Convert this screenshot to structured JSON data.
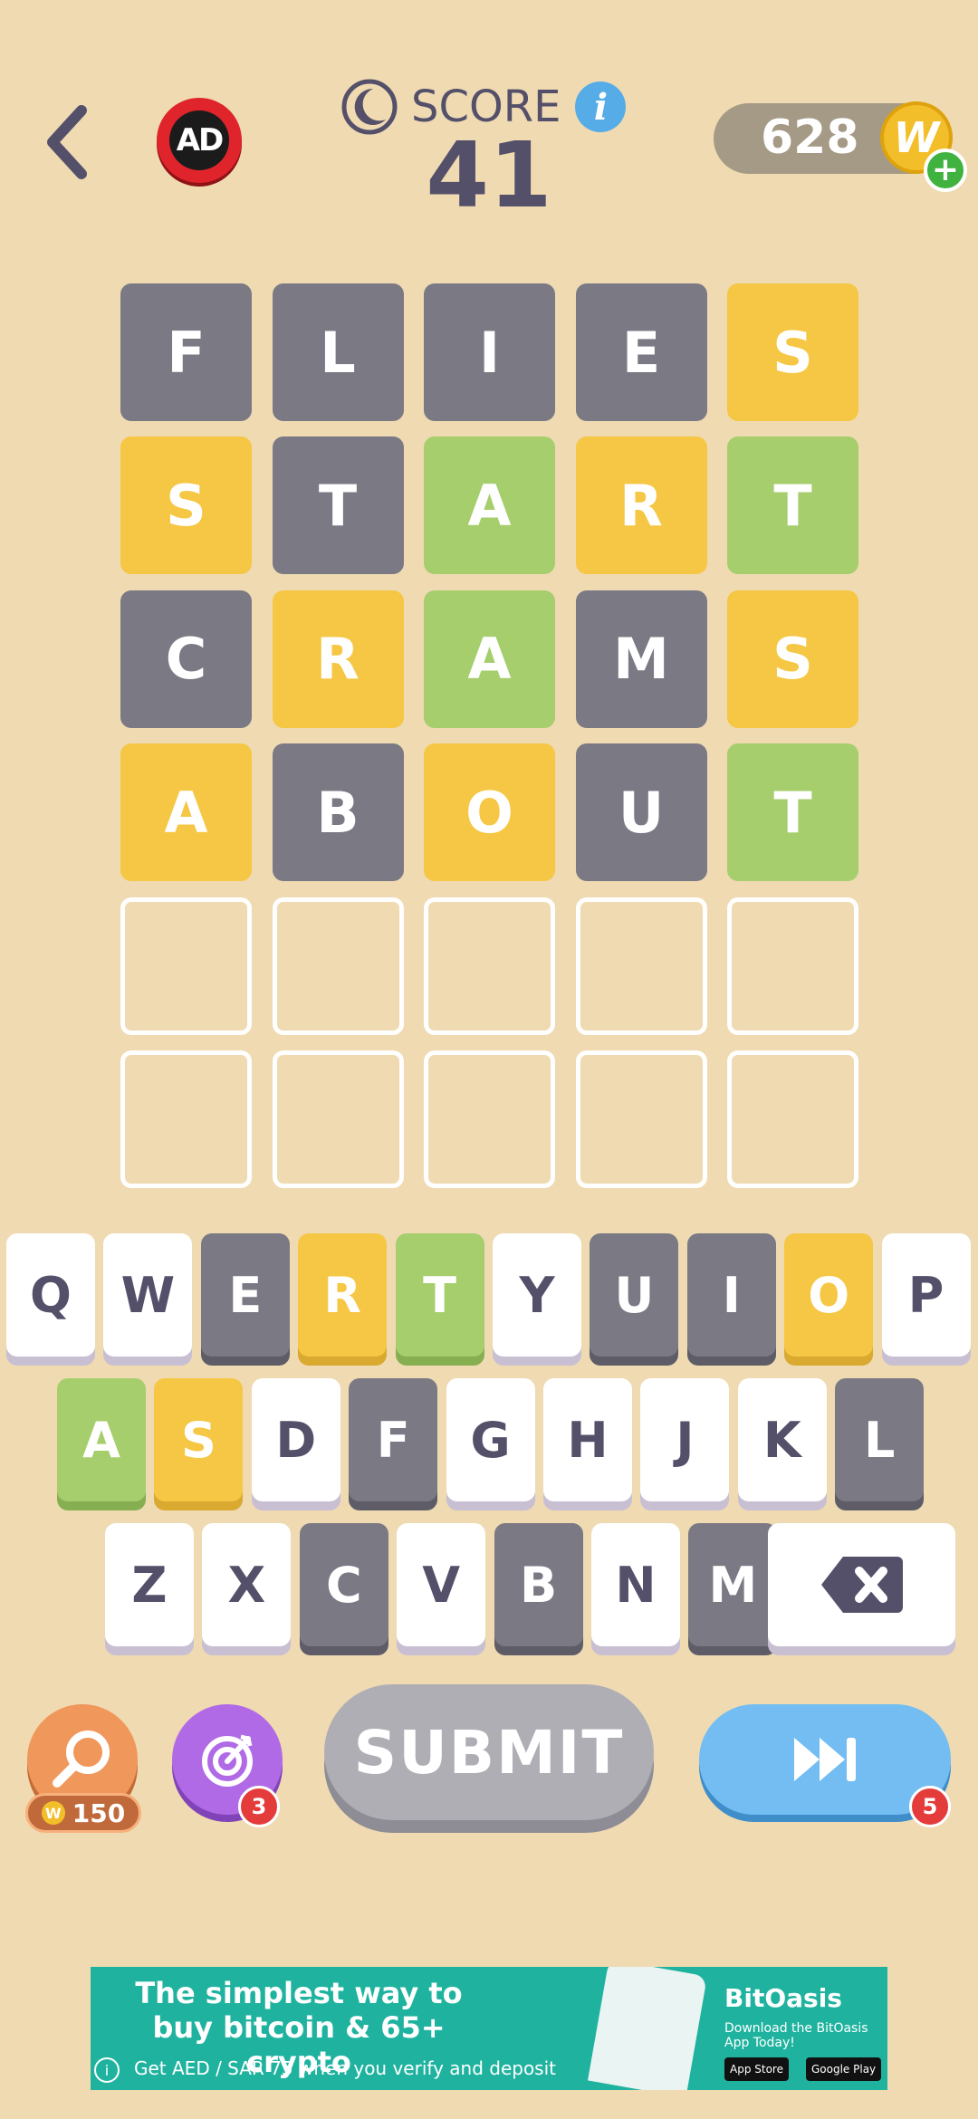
{
  "header": {
    "score_label": "SCORE",
    "score_value": "41",
    "info_glyph": "i",
    "coins": "628",
    "coin_glyph": "W",
    "plus_glyph": "+",
    "ad_label": "AD",
    "icons": [
      "back-chevron-icon",
      "ad-icon",
      "moon-icon",
      "info-icon",
      "coin-icon",
      "plus-icon"
    ]
  },
  "board": {
    "rows": [
      [
        {
          "l": "F",
          "s": "gray"
        },
        {
          "l": "L",
          "s": "gray"
        },
        {
          "l": "I",
          "s": "gray"
        },
        {
          "l": "E",
          "s": "gray"
        },
        {
          "l": "S",
          "s": "yellow"
        }
      ],
      [
        {
          "l": "S",
          "s": "yellow"
        },
        {
          "l": "T",
          "s": "gray"
        },
        {
          "l": "A",
          "s": "green"
        },
        {
          "l": "R",
          "s": "yellow"
        },
        {
          "l": "T",
          "s": "green"
        }
      ],
      [
        {
          "l": "C",
          "s": "gray"
        },
        {
          "l": "R",
          "s": "yellow"
        },
        {
          "l": "A",
          "s": "green"
        },
        {
          "l": "M",
          "s": "gray"
        },
        {
          "l": "S",
          "s": "yellow"
        }
      ],
      [
        {
          "l": "A",
          "s": "yellow"
        },
        {
          "l": "B",
          "s": "gray"
        },
        {
          "l": "O",
          "s": "yellow"
        },
        {
          "l": "U",
          "s": "gray"
        },
        {
          "l": "T",
          "s": "green"
        }
      ],
      [
        {
          "l": "",
          "s": "empty"
        },
        {
          "l": "",
          "s": "empty"
        },
        {
          "l": "",
          "s": "empty"
        },
        {
          "l": "",
          "s": "empty"
        },
        {
          "l": "",
          "s": "empty"
        }
      ],
      [
        {
          "l": "",
          "s": "empty"
        },
        {
          "l": "",
          "s": "empty"
        },
        {
          "l": "",
          "s": "empty"
        },
        {
          "l": "",
          "s": "empty"
        },
        {
          "l": "",
          "s": "empty"
        }
      ]
    ]
  },
  "keyboard": {
    "rows": [
      [
        {
          "k": "Q",
          "s": "white"
        },
        {
          "k": "W",
          "s": "white"
        },
        {
          "k": "E",
          "s": "gray"
        },
        {
          "k": "R",
          "s": "yellow"
        },
        {
          "k": "T",
          "s": "green"
        },
        {
          "k": "Y",
          "s": "white"
        },
        {
          "k": "U",
          "s": "gray"
        },
        {
          "k": "I",
          "s": "gray"
        },
        {
          "k": "O",
          "s": "yellow"
        },
        {
          "k": "P",
          "s": "white"
        }
      ],
      [
        {
          "k": "A",
          "s": "green"
        },
        {
          "k": "S",
          "s": "yellow"
        },
        {
          "k": "D",
          "s": "white"
        },
        {
          "k": "F",
          "s": "gray"
        },
        {
          "k": "G",
          "s": "white"
        },
        {
          "k": "H",
          "s": "white"
        },
        {
          "k": "J",
          "s": "white"
        },
        {
          "k": "K",
          "s": "white"
        },
        {
          "k": "L",
          "s": "gray"
        }
      ],
      [
        {
          "k": "Z",
          "s": "white"
        },
        {
          "k": "X",
          "s": "white"
        },
        {
          "k": "C",
          "s": "gray"
        },
        {
          "k": "V",
          "s": "white"
        },
        {
          "k": "B",
          "s": "gray"
        },
        {
          "k": "N",
          "s": "white"
        },
        {
          "k": "M",
          "s": "gray"
        }
      ]
    ],
    "backspace_icon": "backspace-icon"
  },
  "controls": {
    "hint_cost": "150",
    "target_badge": "3",
    "submit_label": "SUBMIT",
    "skip_badge": "5",
    "icons": [
      "magnifier-icon",
      "target-icon",
      "fast-forward-icon"
    ]
  },
  "ad_banner": {
    "headline": "The simplest way to buy bitcoin & 65+ crypto",
    "sub": "Get AED / SAR 75 when you verify and deposit",
    "brand": "BitOasis",
    "brand_sub": "Download the BitOasis App Today!",
    "store_1": "App Store",
    "store_2": "Google Play",
    "info_glyph": "i"
  },
  "colors": {
    "background": "#EFDAB2",
    "gray_tile": "#7A7984",
    "yellow_tile": "#F5C744",
    "green_tile": "#A6CE6C",
    "text_dark": "#54506A",
    "ad_banner": "#1FB39F"
  }
}
